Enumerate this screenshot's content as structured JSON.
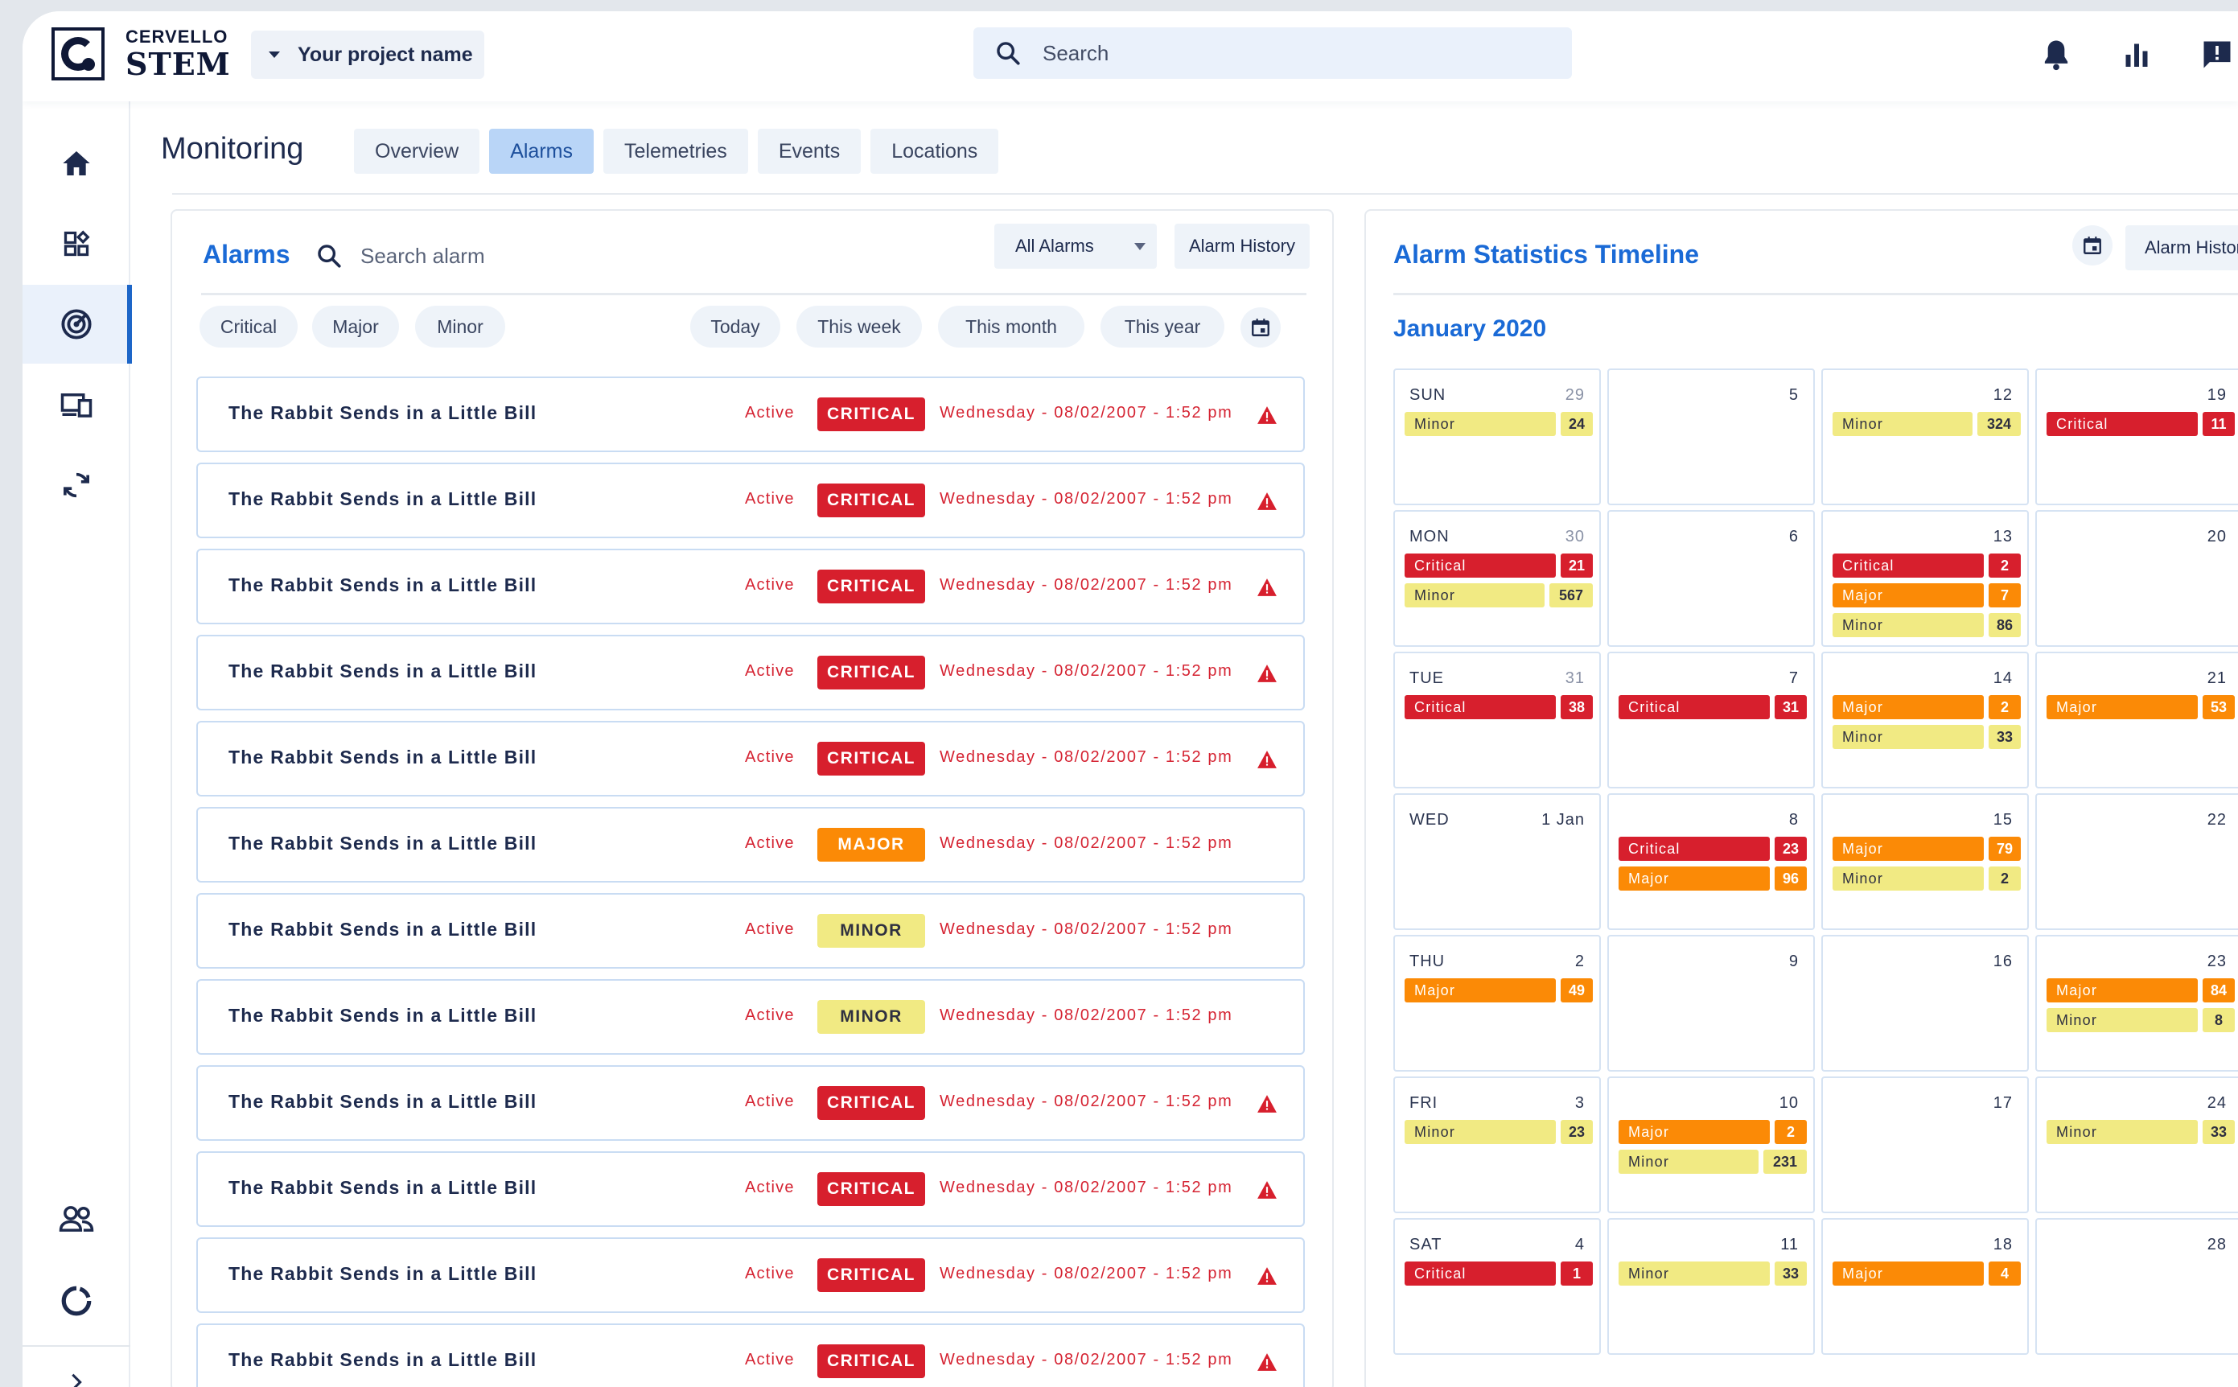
{
  "brand": {
    "line1": "CERVELLO",
    "line2": "STEM"
  },
  "project": {
    "label": "Your project name"
  },
  "search": {
    "placeholder": "Search"
  },
  "page": {
    "title": "Monitoring",
    "tabs": [
      {
        "label": "Overview",
        "active": false
      },
      {
        "label": "Alarms",
        "active": true
      },
      {
        "label": "Telemetries",
        "active": false
      },
      {
        "label": "Events",
        "active": false
      },
      {
        "label": "Locations",
        "active": false
      }
    ]
  },
  "alarms_panel": {
    "title": "Alarms",
    "search_placeholder": "Search alarm",
    "filter_value": "All Alarms",
    "history_label": "Alarm History",
    "severity_chips": [
      "Critical",
      "Major",
      "Minor"
    ],
    "period_chips": [
      "Today",
      "This week",
      "This month",
      "This year"
    ],
    "rows": [
      {
        "name": "The Rabbit Sends in a Little Bill",
        "status": "Active",
        "severity": "CRITICAL",
        "level": "critical",
        "date": "Wednesday - 08/02/2007 - 1:52 pm",
        "warning": true
      },
      {
        "name": "The Rabbit Sends in a Little Bill",
        "status": "Active",
        "severity": "CRITICAL",
        "level": "critical",
        "date": "Wednesday - 08/02/2007 - 1:52 pm",
        "warning": true
      },
      {
        "name": "The Rabbit Sends in a Little Bill",
        "status": "Active",
        "severity": "CRITICAL",
        "level": "critical",
        "date": "Wednesday - 08/02/2007 - 1:52 pm",
        "warning": true
      },
      {
        "name": "The Rabbit Sends in a Little Bill",
        "status": "Active",
        "severity": "CRITICAL",
        "level": "critical",
        "date": "Wednesday - 08/02/2007 - 1:52 pm",
        "warning": true
      },
      {
        "name": "The Rabbit Sends in a Little Bill",
        "status": "Active",
        "severity": "CRITICAL",
        "level": "critical",
        "date": "Wednesday - 08/02/2007 - 1:52 pm",
        "warning": true
      },
      {
        "name": "The Rabbit Sends in a Little Bill",
        "status": "Active",
        "severity": "MAJOR",
        "level": "major",
        "date": "Wednesday - 08/02/2007 - 1:52 pm",
        "warning": false
      },
      {
        "name": "The Rabbit Sends in a Little Bill",
        "status": "Active",
        "severity": "MINOR",
        "level": "minor",
        "date": "Wednesday - 08/02/2007 - 1:52 pm",
        "warning": false
      },
      {
        "name": "The Rabbit Sends in a Little Bill",
        "status": "Active",
        "severity": "MINOR",
        "level": "minor",
        "date": "Wednesday - 08/02/2007 - 1:52 pm",
        "warning": false
      },
      {
        "name": "The Rabbit Sends in a Little Bill",
        "status": "Active",
        "severity": "CRITICAL",
        "level": "critical",
        "date": "Wednesday - 08/02/2007 - 1:52 pm",
        "warning": true
      },
      {
        "name": "The Rabbit Sends in a Little Bill",
        "status": "Active",
        "severity": "CRITICAL",
        "level": "critical",
        "date": "Wednesday - 08/02/2007 - 1:52 pm",
        "warning": true
      },
      {
        "name": "The Rabbit Sends in a Little Bill",
        "status": "Active",
        "severity": "CRITICAL",
        "level": "critical",
        "date": "Wednesday - 08/02/2007 - 1:52 pm",
        "warning": true
      },
      {
        "name": "The Rabbit Sends in a Little Bill",
        "status": "Active",
        "severity": "CRITICAL",
        "level": "critical",
        "date": "Wednesday - 08/02/2007 - 1:52 pm",
        "warning": true
      }
    ]
  },
  "timeline_panel": {
    "title": "Alarm Statistics Timeline",
    "history_label": "Alarm History",
    "month": "January 2020",
    "day_names": [
      "SUN",
      "MON",
      "TUE",
      "WED",
      "THU",
      "FRI",
      "SAT"
    ],
    "columns": [
      [
        {
          "day": "29",
          "prev": true,
          "events": [
            {
              "label": "Minor",
              "level": "minor",
              "count": "24"
            }
          ]
        },
        {
          "day": "30",
          "prev": true,
          "events": [
            {
              "label": "Critical",
              "level": "critical",
              "count": "21"
            },
            {
              "label": "Minor",
              "level": "minor",
              "count": "567"
            }
          ]
        },
        {
          "day": "31",
          "prev": true,
          "events": [
            {
              "label": "Critical",
              "level": "critical",
              "count": "38"
            }
          ]
        },
        {
          "day": "1 Jan",
          "prev": false,
          "events": []
        },
        {
          "day": "2",
          "prev": false,
          "events": [
            {
              "label": "Major",
              "level": "major",
              "count": "49"
            }
          ]
        },
        {
          "day": "3",
          "prev": false,
          "events": [
            {
              "label": "Minor",
              "level": "minor",
              "count": "23"
            }
          ]
        },
        {
          "day": "4",
          "prev": false,
          "events": [
            {
              "label": "Critical",
              "level": "critical",
              "count": "1"
            }
          ]
        }
      ],
      [
        {
          "day": "5",
          "events": []
        },
        {
          "day": "6",
          "events": []
        },
        {
          "day": "7",
          "events": [
            {
              "label": "Critical",
              "level": "critical",
              "count": "31"
            }
          ]
        },
        {
          "day": "8",
          "events": [
            {
              "label": "Critical",
              "level": "critical",
              "count": "23"
            },
            {
              "label": "Major",
              "level": "major",
              "count": "96"
            }
          ]
        },
        {
          "day": "9",
          "events": []
        },
        {
          "day": "10",
          "events": [
            {
              "label": "Major",
              "level": "major",
              "count": "2"
            },
            {
              "label": "Minor",
              "level": "minor",
              "count": "231"
            }
          ]
        },
        {
          "day": "11",
          "events": [
            {
              "label": "Minor",
              "level": "minor",
              "count": "33"
            }
          ]
        }
      ],
      [
        {
          "day": "12",
          "events": [
            {
              "label": "Minor",
              "level": "minor",
              "count": "324"
            }
          ]
        },
        {
          "day": "13",
          "events": [
            {
              "label": "Critical",
              "level": "critical",
              "count": "2"
            },
            {
              "label": "Major",
              "level": "major",
              "count": "7"
            },
            {
              "label": "Minor",
              "level": "minor",
              "count": "86"
            }
          ]
        },
        {
          "day": "14",
          "events": [
            {
              "label": "Major",
              "level": "major",
              "count": "2"
            },
            {
              "label": "Minor",
              "level": "minor",
              "count": "33"
            }
          ]
        },
        {
          "day": "15",
          "events": [
            {
              "label": "Major",
              "level": "major",
              "count": "79"
            },
            {
              "label": "Minor",
              "level": "minor",
              "count": "2"
            }
          ]
        },
        {
          "day": "16",
          "events": []
        },
        {
          "day": "17",
          "events": []
        },
        {
          "day": "18",
          "events": [
            {
              "label": "Major",
              "level": "major",
              "count": "4"
            }
          ]
        }
      ],
      [
        {
          "day": "19",
          "events": [
            {
              "label": "Critical",
              "level": "critical",
              "count": "11"
            }
          ]
        },
        {
          "day": "20",
          "events": []
        },
        {
          "day": "21",
          "events": [
            {
              "label": "Major",
              "level": "major",
              "count": "53"
            }
          ]
        },
        {
          "day": "22",
          "events": []
        },
        {
          "day": "23",
          "events": [
            {
              "label": "Major",
              "level": "major",
              "count": "84"
            },
            {
              "label": "Minor",
              "level": "minor",
              "count": "8"
            }
          ]
        },
        {
          "day": "24",
          "events": [
            {
              "label": "Minor",
              "level": "minor",
              "count": "33"
            }
          ]
        },
        {
          "day": "28",
          "events": []
        }
      ]
    ]
  },
  "colors": {
    "accent": "#1a6ad6",
    "critical": "#d71f2d",
    "major": "#fb8a06",
    "minor": "#f1ea83",
    "navy": "#1d2a4d"
  }
}
